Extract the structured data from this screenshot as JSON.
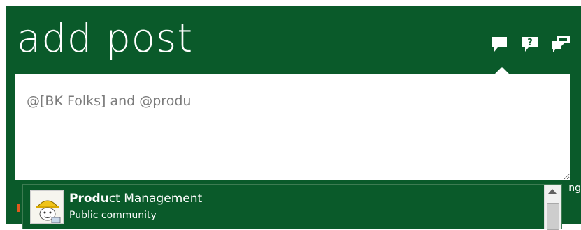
{
  "header": {
    "title": "add post"
  },
  "toolbar": {
    "icons": [
      "comment-icon",
      "question-icon",
      "conversation-icon"
    ]
  },
  "composer": {
    "value": "@[BK Folks] and @produ"
  },
  "edge_text": "ng",
  "suggestions": [
    {
      "name_bold": "Produ",
      "name_rest": "ct Management",
      "subtitle": "Public community",
      "avatar": "community-avatar"
    }
  ],
  "colors": {
    "header_bg": "#0a5a2a",
    "text": "#ffffff",
    "input_text": "#7b7b7b"
  }
}
